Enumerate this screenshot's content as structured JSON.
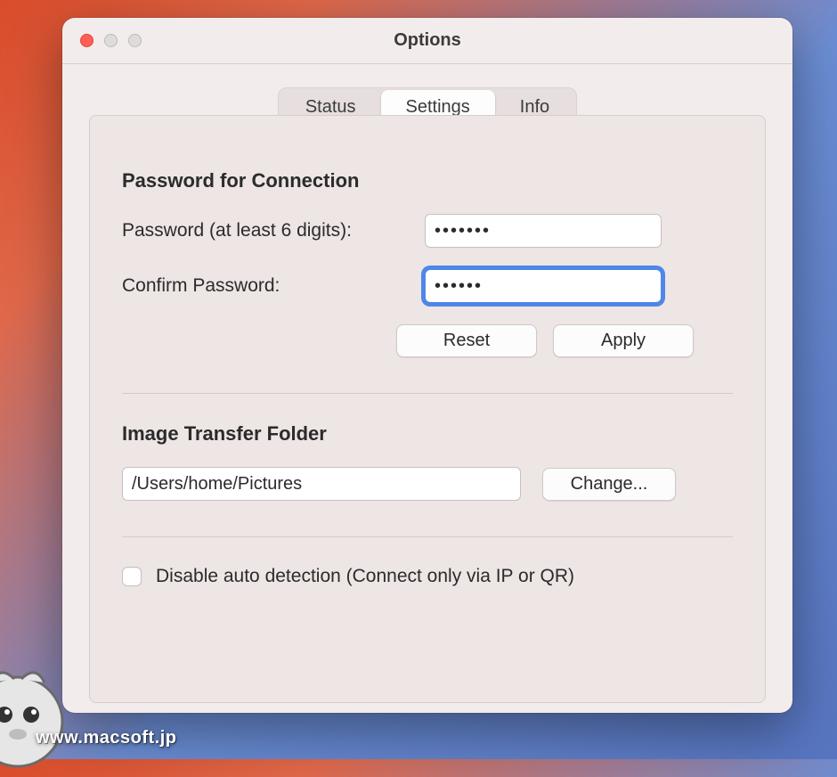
{
  "window": {
    "title": "Options"
  },
  "tabs": {
    "status": "Status",
    "settings": "Settings",
    "info": "Info",
    "active": "settings"
  },
  "section_password": {
    "title": "Password for Connection",
    "password_label": "Password (at least 6 digits):",
    "password_value": "•••••••",
    "confirm_label": "Confirm Password:",
    "confirm_value": "••••••",
    "reset_label": "Reset",
    "apply_label": "Apply"
  },
  "section_folder": {
    "title": "Image Transfer Folder",
    "path_value": "/Users/home/Pictures",
    "change_label": "Change..."
  },
  "section_autodetect": {
    "checked": false,
    "label": "Disable auto detection (Connect only via IP or QR)"
  },
  "watermark": "www.macsoft.jp"
}
